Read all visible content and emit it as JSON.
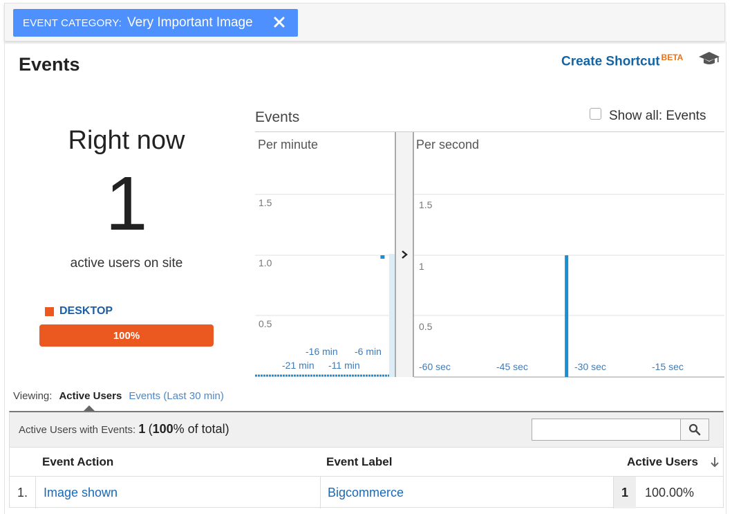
{
  "filter": {
    "key": "EVENT CATEGORY:",
    "value": "Very Important Image"
  },
  "page": {
    "title": "Events",
    "shortcut_label": "Create Shortcut",
    "shortcut_badge": "BETA"
  },
  "right_now": {
    "title": "Right now",
    "count": "1",
    "subtitle": "active users on site",
    "device_label": "DESKTOP",
    "device_percent": "100%",
    "device_fraction": 1.0,
    "device_color": "#eb5920"
  },
  "chart": {
    "heading": "Events",
    "show_all_label": "Show all: Events",
    "show_all_checked": false,
    "per_minute_title": "Per minute",
    "per_second_title": "Per second",
    "per_minute_yticks": [
      "1.5",
      "1.0",
      "0.5"
    ],
    "per_second_yticks": [
      "1.5",
      "1",
      "0.5"
    ],
    "per_minute_xticks_upper": [
      "-16 min",
      "-6 min"
    ],
    "per_minute_xticks_lower": [
      "-21 min",
      "-11 min"
    ],
    "per_second_xticks": [
      "-60 sec",
      "-45 sec",
      "-30 sec",
      "-15 sec"
    ],
    "accent_color": "#1a8fd2"
  },
  "chart_data": [
    {
      "type": "bar",
      "title": "Per minute",
      "x": [
        -1
      ],
      "values": [
        1
      ],
      "ylim": [
        0,
        1.5
      ],
      "grid": true
    },
    {
      "type": "bar",
      "title": "Per second",
      "x": [
        -34
      ],
      "values": [
        1
      ],
      "ylim": [
        0,
        1.5
      ],
      "grid": true
    }
  ],
  "viewing": {
    "label": "Viewing:",
    "active_tab": "Active Users",
    "other_tab": "Events (Last 30 min)"
  },
  "table": {
    "summary_label": "Active Users with Events:",
    "summary_count": "1",
    "summary_pct": "100",
    "summary_suffix": "% of total)",
    "summary_open": "(",
    "search_placeholder": "",
    "columns": [
      "Event Action",
      "Event Label",
      "Active Users"
    ],
    "rows": [
      {
        "index": "1.",
        "action": "Image shown",
        "label": "Bigcommerce",
        "users": "1",
        "pct": "100.00%"
      }
    ]
  }
}
